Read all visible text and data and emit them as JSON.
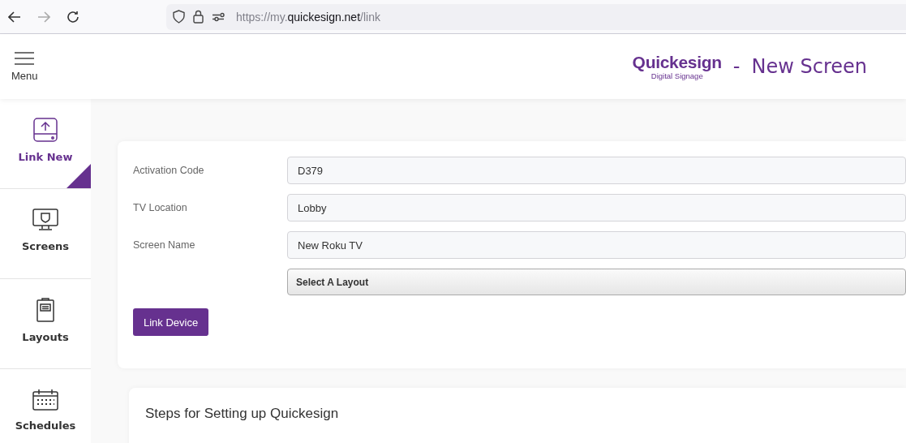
{
  "browser": {
    "url": {
      "scheme": "https://my.",
      "domain": "quickesign.net",
      "path": "/link"
    }
  },
  "header": {
    "menu_label": "Menu",
    "logo": {
      "name": "Quickesign",
      "tagline": "Digital Signage"
    },
    "separator": "-",
    "title": "New Screen"
  },
  "sidebar": {
    "items": [
      {
        "label": "Link New",
        "selected": true
      },
      {
        "label": "Screens",
        "selected": false
      },
      {
        "label": "Layouts",
        "selected": false
      },
      {
        "label": "Schedules",
        "selected": false
      }
    ]
  },
  "form": {
    "fields": [
      {
        "label": "Activation Code",
        "value": "D379"
      },
      {
        "label": "TV Location",
        "value": "Lobby"
      },
      {
        "label": "Screen Name",
        "value": "New Roku TV"
      }
    ],
    "layout_select": "Select A Layout",
    "submit": "Link Device"
  },
  "steps": {
    "title": "Steps for Setting up Quickesign"
  }
}
